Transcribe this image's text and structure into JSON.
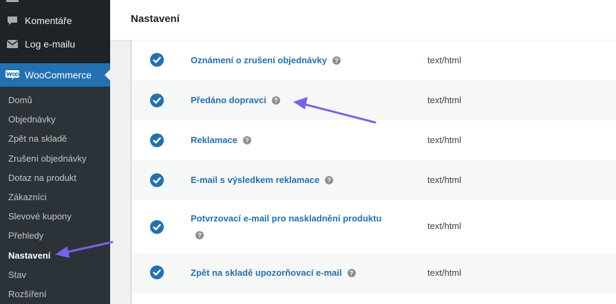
{
  "sidebar": {
    "items": [
      {
        "label": "Komentáře",
        "icon": "comment-icon"
      },
      {
        "label": "Log e-mailu",
        "icon": "email-icon"
      },
      {
        "label": "WooCommerce",
        "icon": "woocommerce-icon"
      }
    ],
    "submenu": [
      "Domů",
      "Objednávky",
      "Zpět na skladě",
      "Zrušení objednávky",
      "Dotaz na produkt",
      "Zákazníci",
      "Slevové kupony",
      "Přehledy",
      "Nastavení",
      "Stav",
      "Rozšíření"
    ],
    "current": "Nastavení"
  },
  "header": {
    "title": "Nastavení"
  },
  "emails": [
    {
      "name": "Oznámení o zrušení objednávky",
      "type": "text/html",
      "enabled": true
    },
    {
      "name": "Předáno dopravci",
      "type": "text/html",
      "enabled": true
    },
    {
      "name": "Reklamace",
      "type": "text/html",
      "enabled": true
    },
    {
      "name": "E-mail s výsledkem reklamace",
      "type": "text/html",
      "enabled": true
    },
    {
      "name": "Potvrzovací e-mail pro naskladnění produktu",
      "type": "text/html",
      "enabled": true
    },
    {
      "name": "Zpět na skladě upozorňovací e-mail",
      "type": "text/html",
      "enabled": true
    }
  ],
  "help_glyph": "?",
  "colors": {
    "accent": "#2271b1",
    "annotation": "#7b61e8",
    "sidebar": "#1d2327"
  }
}
